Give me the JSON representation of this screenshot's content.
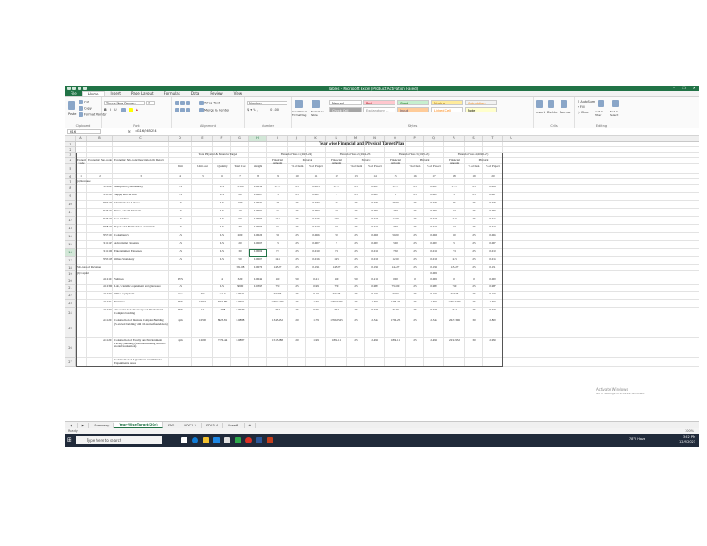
{
  "window": {
    "title": "Tables - Microsoft Excel (Product Activation Failed)",
    "controls": [
      "–",
      "❐",
      "✕"
    ]
  },
  "ribbon": {
    "tabs": [
      "File",
      "Home",
      "Insert",
      "Page Layout",
      "Formulas",
      "Data",
      "Review",
      "View"
    ],
    "active_tab": "Home",
    "clipboard": {
      "paste": "Paste",
      "cut": "Cut",
      "copy": "Copy",
      "format_painter": "Format Painter",
      "label": "Clipboard"
    },
    "font": {
      "name": "Times New Roman",
      "size": "7",
      "label": "Font"
    },
    "alignment": {
      "wrap": "Wrap Text",
      "merge": "Merge & Center",
      "label": "Alignment"
    },
    "number": {
      "format": "Number",
      "label": "Number"
    },
    "styles": {
      "conditional": "Conditional Formatting",
      "format_table": "Format as Table",
      "cells": [
        {
          "label": "Normal",
          "bg": "#ffffff",
          "fg": "#000000"
        },
        {
          "label": "Bad",
          "bg": "#ffc7ce",
          "fg": "#9c0006"
        },
        {
          "label": "Good",
          "bg": "#c6efce",
          "fg": "#006100"
        },
        {
          "label": "Neutral",
          "bg": "#ffeb9c",
          "fg": "#9c6500"
        },
        {
          "label": "Calculation",
          "bg": "#f2f2f2",
          "fg": "#fa7d00"
        },
        {
          "label": "Check Cell",
          "bg": "#a5a5a5",
          "fg": "#ffffff"
        },
        {
          "label": "Explanatory ...",
          "bg": "#ffffff",
          "fg": "#7f7f7f"
        },
        {
          "label": "Input",
          "bg": "#ffcc99",
          "fg": "#3f3f76"
        },
        {
          "label": "Linked Cell",
          "bg": "#ffffff",
          "fg": "#fa7d00"
        },
        {
          "label": "Note",
          "bg": "#ffffcc",
          "fg": "#000000"
        }
      ],
      "label": "Styles"
    },
    "cells": {
      "insert": "Insert",
      "delete": "Delete",
      "format": "Format",
      "label": "Cells"
    },
    "editing": {
      "autosum": "AutoSum",
      "fill": "Fill",
      "clear": "Clear",
      "sort": "Sort & Filter",
      "find": "Find & Select",
      "label": "Editing"
    }
  },
  "formula_bar": {
    "name_box": "H16",
    "fx": "fx",
    "formula": "=G16/565254"
  },
  "columns": [
    "A",
    "B",
    "C",
    "D",
    "E",
    "F",
    "G",
    "H",
    "I",
    "J",
    "K",
    "L",
    "M",
    "N",
    "O",
    "P",
    "Q",
    "R",
    "S",
    "T",
    "U"
  ],
  "selected_column": "H",
  "selected_row": "16",
  "sheet": {
    "title": "Year wise Financial and Physical Target Plan",
    "header": {
      "economic_code": "Economic Code",
      "economic_subcode": "Economic Sub-code",
      "desc": "Economic Sub-code Description (In Detail)",
      "total_group": "Total Physical & Financial Target",
      "unit": "Unit",
      "unit_cost": "Unit cost",
      "quantity": "Quantity",
      "total_cost": "Total Cost",
      "weight": "Weight",
      "years": [
        "Financial Year-1 (2023-24)",
        "Financial Year-2 (2024-25)",
        "Financial Year-3 (2025-26)",
        "Financial Year-4 (2026-27)"
      ],
      "financial_amount": "Financial Amount",
      "physical": "Physical",
      "pct_item": "% of Item",
      "pct_project": "% of Project"
    },
    "index_row": [
      "1",
      "2",
      "3",
      "4",
      "5",
      "6",
      "7",
      "8",
      "9",
      "10",
      "11",
      "12",
      "13",
      "14",
      "15",
      "16",
      "17",
      "18",
      "19",
      "20"
    ],
    "rows": [
      {
        "n": "7",
        "a": "(a) Revenue"
      },
      {
        "n": "8",
        "b": "3111201",
        "c": "Manpower (Contractual)",
        "d": "LS",
        "f": "LS",
        "g": "71.00",
        "h": "0.0039",
        "i": "17.77",
        "j": "25",
        "k": "0.023",
        "l": "17.77",
        "m": "25",
        "n2": "0.023",
        "o": "17.77",
        "p": "25",
        "q": "0.023",
        "r": "17.77",
        "s": "25",
        "t": "0.023"
      },
      {
        "n": "9",
        "b": "3255101",
        "c": "Supply and Service",
        "d": "LS",
        "f": "LS",
        "g": "20",
        "h": "0.0007",
        "i": "5",
        "j": "25",
        "k": "0.007",
        "l": "5",
        "m": "25",
        "n2": "0.007",
        "o": "5",
        "p": "25",
        "q": "0.007",
        "r": "5",
        "s": "25",
        "t": "0.007"
      },
      {
        "n": "10",
        "b": "3256102",
        "c": "Chemicals for Lab use",
        "d": "LS",
        "f": "LS",
        "g": "100",
        "h": "0.0031",
        "i": "25",
        "j": "25",
        "k": "0.033",
        "l": "25",
        "m": "25",
        "n2": "0.033",
        "o": "25.00",
        "p": "25",
        "q": "0.033",
        "r": "25",
        "s": "25",
        "t": "0.033"
      },
      {
        "n": "11",
        "b": "3243101",
        "c": "Petrol, oil and lubricant",
        "d": "LS",
        "f": "LS",
        "g": "10",
        "h": "0.0001",
        "i": "2.5",
        "j": "25",
        "k": "0.003",
        "l": "2.5",
        "m": "25",
        "n2": "0.003",
        "o": "2.50",
        "p": "25",
        "q": "0.003",
        "r": "2.5",
        "s": "25",
        "t": "0.003"
      },
      {
        "n": "12",
        "b": "3243102",
        "c": "Gas and Fuel",
        "d": "LS",
        "f": "LS",
        "g": "50",
        "h": "0.0007",
        "i": "12.5",
        "j": "25",
        "k": "0.016",
        "l": "12.5",
        "m": "25",
        "n2": "0.016",
        "o": "12.50",
        "p": "25",
        "q": "0.016",
        "r": "12.5",
        "s": "25",
        "t": "0.016"
      },
      {
        "n": "13",
        "b": "3258102",
        "c": "Repair and Maintenance of Institute",
        "d": "LS",
        "f": "LS",
        "g": "30",
        "h": "0.0004",
        "i": "7.5",
        "j": "25",
        "k": "0.010",
        "l": "7.5",
        "m": "25",
        "n2": "0.010",
        "o": "7.50",
        "p": "25",
        "q": "0.010",
        "r": "7.5",
        "s": "25",
        "t": "0.010"
      },
      {
        "n": "14",
        "b": "3257101",
        "c": "Consultancy",
        "d": "LS",
        "f": "LS",
        "g": "200",
        "h": "0.0026",
        "i": "50",
        "j": "25",
        "k": "0.066",
        "l": "50",
        "m": "25",
        "n2": "0.066",
        "o": "50.00",
        "p": "25",
        "q": "0.066",
        "r": "50",
        "s": "25",
        "t": "0.066"
      },
      {
        "n": "15",
        "b": "3211125",
        "c": "Advertising Expenses",
        "d": "LS",
        "f": "LS",
        "g": "20",
        "h": "0.0003",
        "i": "5",
        "j": "25",
        "k": "0.007",
        "l": "5",
        "m": "25",
        "n2": "0.007",
        "o": "5.00",
        "p": "25",
        "q": "0.007",
        "r": "5",
        "s": "25",
        "t": "0.007"
      },
      {
        "n": "16",
        "b": "3211106",
        "c": "Entertainment Expenses",
        "d": "LS",
        "f": "LS",
        "g": "30",
        "h": "0.0004",
        "i": "7.5",
        "j": "25",
        "k": "0.010",
        "l": "7.5",
        "m": "25",
        "n2": "0.010",
        "o": "7.50",
        "p": "25",
        "q": "0.010",
        "r": "7.5",
        "s": "25",
        "t": "0.010"
      },
      {
        "n": "17",
        "b": "3255105",
        "c": "Others Stationary",
        "d": "LS",
        "f": "LS",
        "g": "50",
        "h": "0.0007",
        "i": "12.5",
        "j": "25",
        "k": "0.016",
        "l": "12.5",
        "m": "25",
        "n2": "0.016",
        "o": "12.50",
        "p": "25",
        "q": "0.016",
        "r": "12.5",
        "s": "25",
        "t": "0.016"
      },
      {
        "n": "18",
        "a": "Sub-total of Revenue",
        "g": "581.08",
        "h": "0.0076",
        "i": "145.27",
        "j": "25",
        "k": "0.191",
        "l": "145.27",
        "m": "25",
        "n2": "0.191",
        "o": "145.27",
        "p": "25",
        "q": "0.191",
        "r": "145.27",
        "s": "25",
        "t": "0.191"
      },
      {
        "n": "19",
        "a": "(b) Capital",
        "q": "0.000"
      },
      {
        "n": "20",
        "b": "4112101",
        "c": "Vehicles",
        "d": "PVS",
        "f": "4",
        "g": "320",
        "h": "0.0042",
        "i": "160",
        "j": "50",
        "k": "0.21",
        "l": "160",
        "m": "50",
        "n2": "0.210",
        "o": "0.00",
        "p": "0",
        "q": "0.000",
        "r": "0",
        "s": "0",
        "t": "0.000"
      },
      {
        "n": "21",
        "b": "4112306",
        "c": "Lab, Scientific equipment and glassware",
        "d": "LS",
        "f": "LS",
        "g": "3000",
        "h": "0.0393",
        "i": "750",
        "j": "25",
        "k": "0.99",
        "l": "750",
        "m": "25",
        "n2": "0.987",
        "o": "750.00",
        "p": "25",
        "q": "0.987",
        "r": "750",
        "s": "25",
        "t": "0.987"
      },
      {
        "n": "22",
        "b": "4112315",
        "c": "Office equipment",
        "d": "Nos",
        "e": "450",
        "f": "311.7",
        "g": "0.0041",
        "h": "",
        "i": "77.925",
        "j": "25",
        "k": "0.10",
        "l": "77.925",
        "m": "25",
        "n2": "0.103",
        "o": "77.93",
        "p": "25",
        "q": "0.103",
        "r": "77.925",
        "s": "25",
        "t": "0.103"
      },
      {
        "n": "23",
        "b": "4112314",
        "c": "Furniture",
        "d": "PVS",
        "e": "10004",
        "f": "5052.89",
        "g": "0.0661",
        "h": "",
        "i": "1263.2225",
        "j": "25",
        "k": "1.66",
        "l": "1263.2225",
        "m": "25",
        "n2": "1.663",
        "o": "1263.22",
        "p": "25",
        "q": "1.663",
        "r": "1263.2225",
        "s": "25",
        "t": "1.663"
      },
      {
        "n": "24",
        "b": "4112316",
        "c": "Air cooler for Laboratory and International Complex building",
        "d": "PVS",
        "e": "144",
        "f": "1498",
        "g": "0.0030",
        "h": "",
        "i": "37.4",
        "j": "25",
        "k": "0.05",
        "l": "37.4",
        "m": "25",
        "n2": "0.049",
        "o": "37.40",
        "p": "25",
        "q": "0.049",
        "r": "37.4",
        "s": "25",
        "t": "0.049"
      },
      {
        "n": "25",
        "b": "2111201",
        "c": "Construction of Institute Complex Building (5-storied building with 10-storied foundation)",
        "d": "sqm",
        "e": "10500",
        "f": "8823.81",
        "g": "0.0888",
        "h": "",
        "i": "1345.952",
        "j": "20",
        "k": "1.79",
        "l": "1766.2525",
        "m": "25",
        "n2": "2.344",
        "o": "1766.25",
        "p": "25",
        "q": "2.344",
        "r": "2647.306",
        "s": "30",
        "t": "2.800"
      },
      {
        "n": "26",
        "b": "2111201",
        "c": "Construction of Faculty and Environment Facility Building (2-storied building with 10-storied foundation)",
        "d": "sqm",
        "e": "12000",
        "f": "7376.44",
        "g": "0.0887",
        "h": "",
        "i": "1515.288",
        "j": "20",
        "k": "1.99",
        "l": "1894.11",
        "m": "25",
        "n2": "2.491",
        "o": "1894.11",
        "p": "25",
        "q": "2.491",
        "r": "2272.932",
        "s": "30",
        "t": "2.999"
      },
      {
        "n": "27",
        "c": "Construction of Agricultural and Fisheries Experimental Area"
      }
    ]
  },
  "sheet_tabs": [
    "Summary",
    "Year-Wise-Target(20y)",
    "SDG",
    "NDC1-2",
    "SDG3-4",
    "Sheet4"
  ],
  "active_sheet_tab": "Year-Wise-Target(20y)",
  "status": {
    "left": "Ready",
    "zoom": "100%"
  },
  "watermark": {
    "line1": "Activate Windows",
    "line2": "Go to Settings to activate Windows."
  },
  "taskbar": {
    "search_placeholder": "Type here to search",
    "weather": "78°F Haze",
    "time": "3:52 PM",
    "date": "12/9/2023"
  }
}
